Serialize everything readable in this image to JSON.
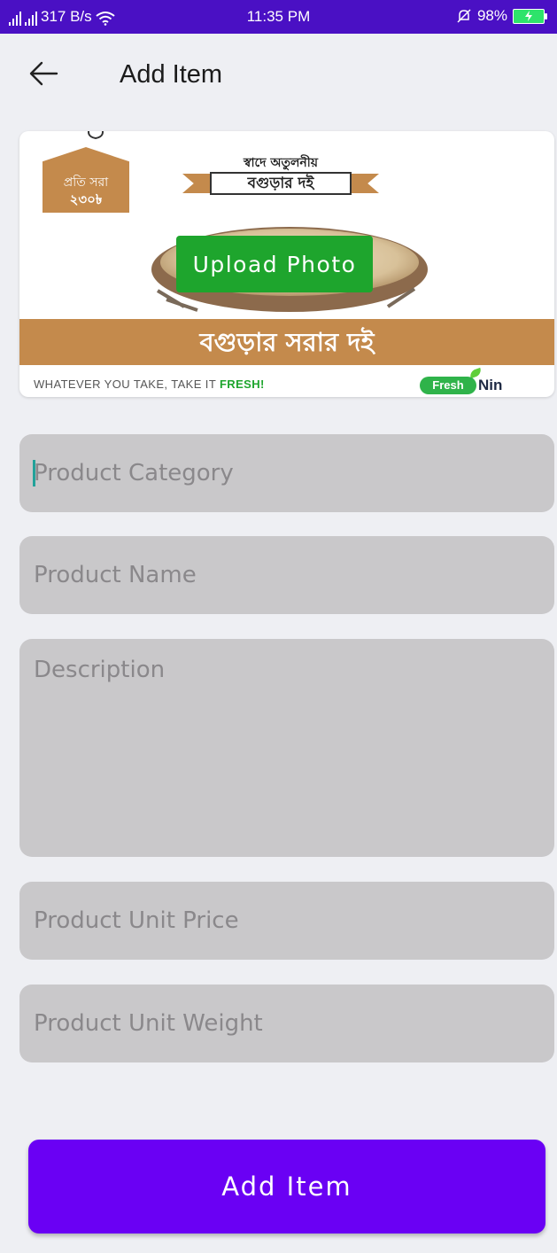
{
  "status_bar": {
    "network_speed": "317 B/s",
    "time": "11:35 PM",
    "battery": "98%"
  },
  "app_bar": {
    "title": "Add Item",
    "back_icon": "arrow-left-icon"
  },
  "banner": {
    "price_tag_line1": "প্রতি সরা",
    "price_tag_line2": "২৩০৳",
    "ribbon_top": "স্বাদে অতুলনীয়",
    "ribbon_main": "বগুড়ার দই",
    "strip_text": "বগুড়ার সরার দই",
    "tagline": "WHATEVER YOU TAKE, TAKE IT ",
    "tagline_highlight": "FRESH!",
    "logo_left": "Fresh",
    "logo_right": "Nin",
    "upload_label": "Upload Photo"
  },
  "form": {
    "category_placeholder": "Product Category",
    "name_placeholder": "Product Name",
    "description_placeholder": "Description",
    "price_placeholder": "Product Unit Price",
    "weight_placeholder": "Product Unit Weight"
  },
  "actions": {
    "add_label": "Add Item"
  },
  "colors": {
    "status_bar": "#4a10c4",
    "primary_button": "#6a00f4",
    "upload_button": "#1ea52d",
    "field_bg": "#c9c8ca",
    "banner_accent": "#c48a4c"
  }
}
